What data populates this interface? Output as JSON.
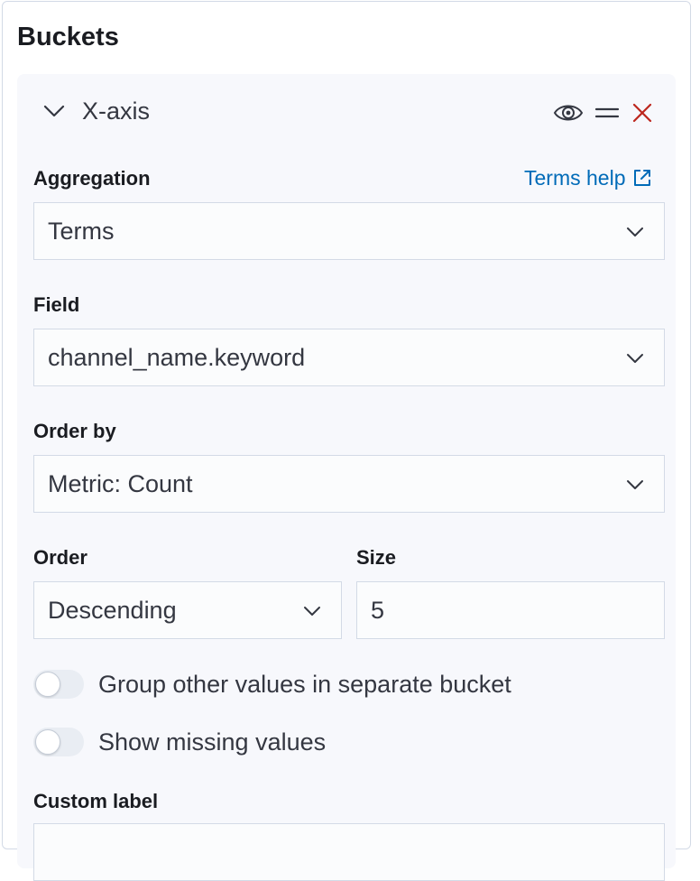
{
  "panel": {
    "title": "Buckets"
  },
  "bucket": {
    "title": "X-axis",
    "icons": [
      "chevron-down-icon",
      "eye-icon",
      "drag-handle-icon",
      "close-icon"
    ],
    "colors": {
      "close": "#bd271e",
      "link": "#006bb8"
    }
  },
  "aggregation": {
    "label": "Aggregation",
    "help_link": "Terms help",
    "value": "Terms"
  },
  "field": {
    "label": "Field",
    "value": "channel_name.keyword"
  },
  "order_by": {
    "label": "Order by",
    "value": "Metric: Count"
  },
  "order": {
    "label": "Order",
    "value": "Descending"
  },
  "size": {
    "label": "Size",
    "value": "5"
  },
  "toggles": {
    "other_bucket": {
      "label": "Group other values in separate bucket",
      "checked": false
    },
    "missing": {
      "label": "Show missing values",
      "checked": false
    }
  },
  "custom_label": {
    "label": "Custom label",
    "value": ""
  }
}
